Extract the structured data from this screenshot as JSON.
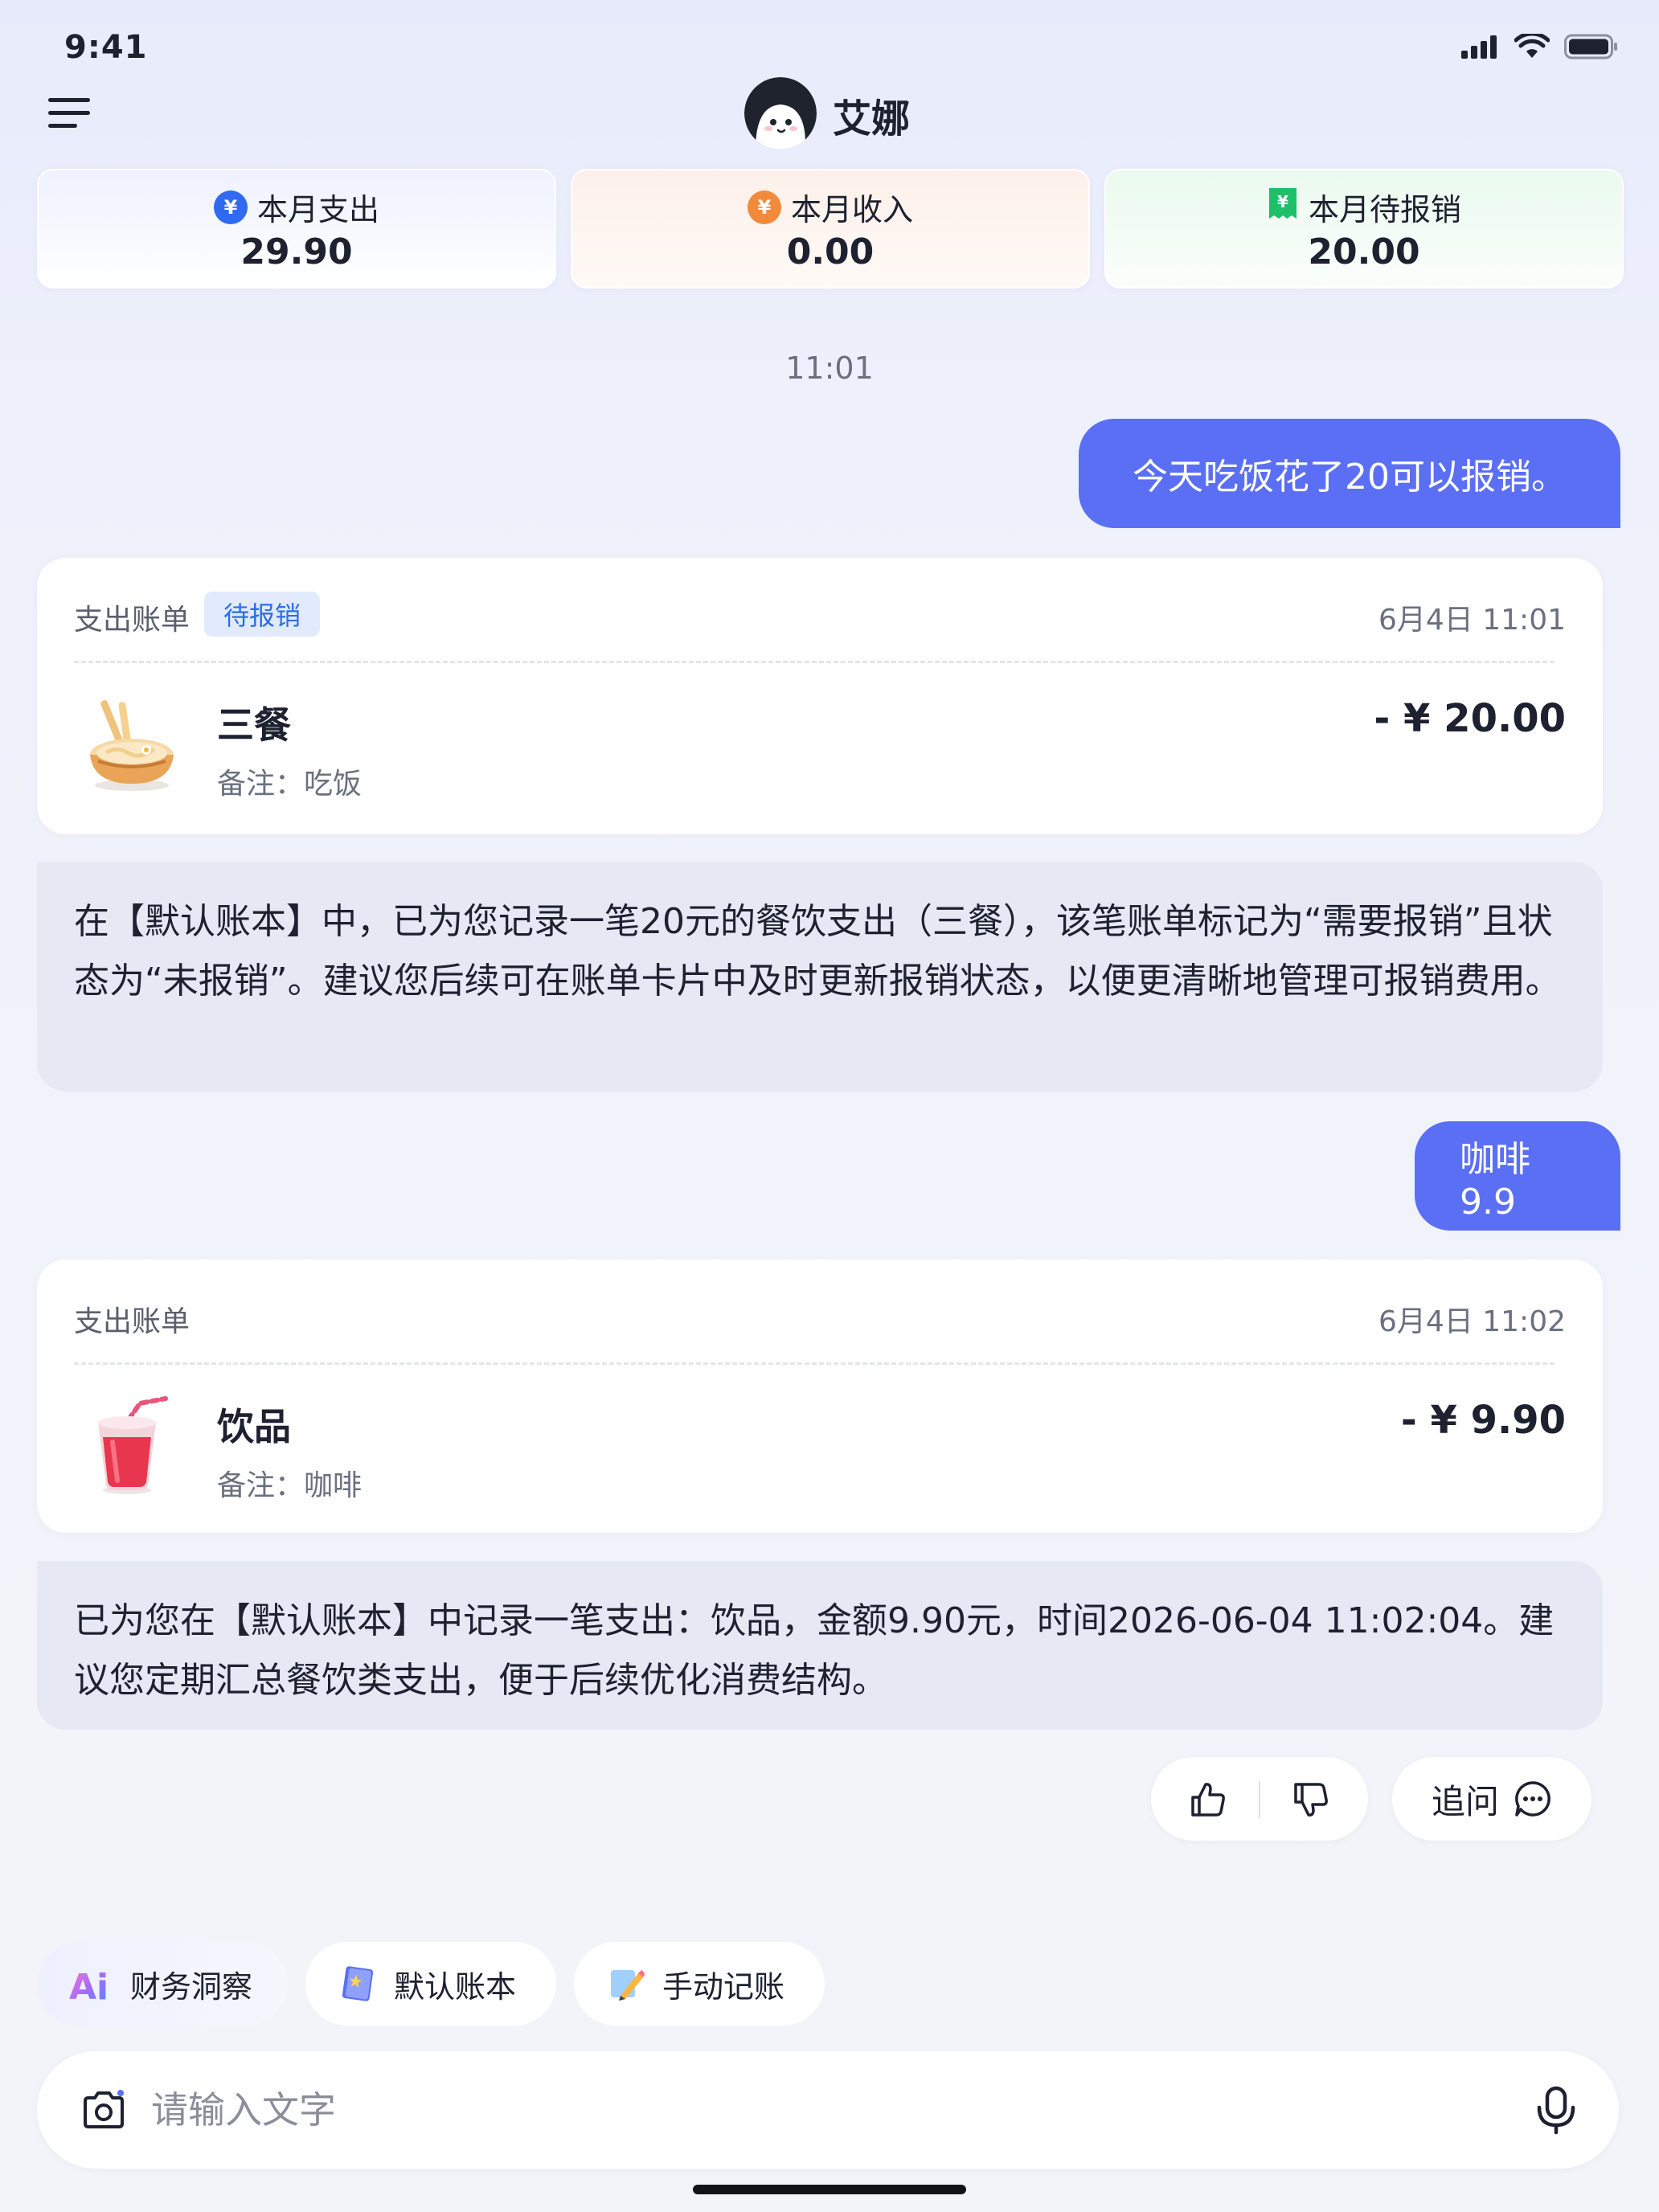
{
  "status_bar": {
    "time": "9:41"
  },
  "header": {
    "title": "艾娜"
  },
  "summary": [
    {
      "label": "本月支出",
      "value": "29.90",
      "icon_glyph": "¥",
      "icon": "yen-coin-blue-icon",
      "color": "#2f6af0"
    },
    {
      "label": "本月收入",
      "value": "0.00",
      "icon_glyph": "¥",
      "icon": "yen-coin-orange-icon",
      "color": "#f28a3c"
    },
    {
      "label": "本月待报销",
      "value": "20.00",
      "icon_glyph": "¥",
      "icon": "receipt-green-icon",
      "color": "#1fbf6a"
    }
  ],
  "chat": {
    "timestamp": "11:01",
    "user_messages": [
      "今天吃饭花了20可以报销。",
      "咖啡9.9"
    ],
    "bills": [
      {
        "type": "支出账单",
        "tag": "待报销",
        "date": "6月4日 11:01",
        "name": "三餐",
        "note": "备注：吃饭",
        "amount": "- ¥ 20.00",
        "icon": "noodle-bowl-icon"
      },
      {
        "type": "支出账单",
        "tag": "",
        "date": "6月4日 11:02",
        "name": "饮品",
        "note": "备注：咖啡",
        "amount": "- ¥ 9.90",
        "icon": "drink-cup-icon"
      }
    ],
    "ai_messages": [
      "在【默认账本】中，已为您记录一笔20元的餐饮支出（三餐），该笔账单标记为“需要报销”且状态为“未报销”。建议您后续可在账单卡片中及时更新报销状态，以便更清晰地管理可报销费用。",
      "已为您在【默认账本】中记录一笔支出：饮品，金额9.90元，时间2026-06-04 11:02:04。建议您定期汇总餐饮类支出，便于后续优化消费结构。"
    ]
  },
  "feedback": {
    "follow_up_label": "追问"
  },
  "quick_actions": [
    {
      "label": "财务洞察",
      "icon": "ai-sparkle-icon"
    },
    {
      "label": "默认账本",
      "icon": "ledger-book-icon"
    },
    {
      "label": "手动记账",
      "icon": "pencil-note-icon"
    }
  ],
  "input": {
    "placeholder": "请输入文字"
  }
}
